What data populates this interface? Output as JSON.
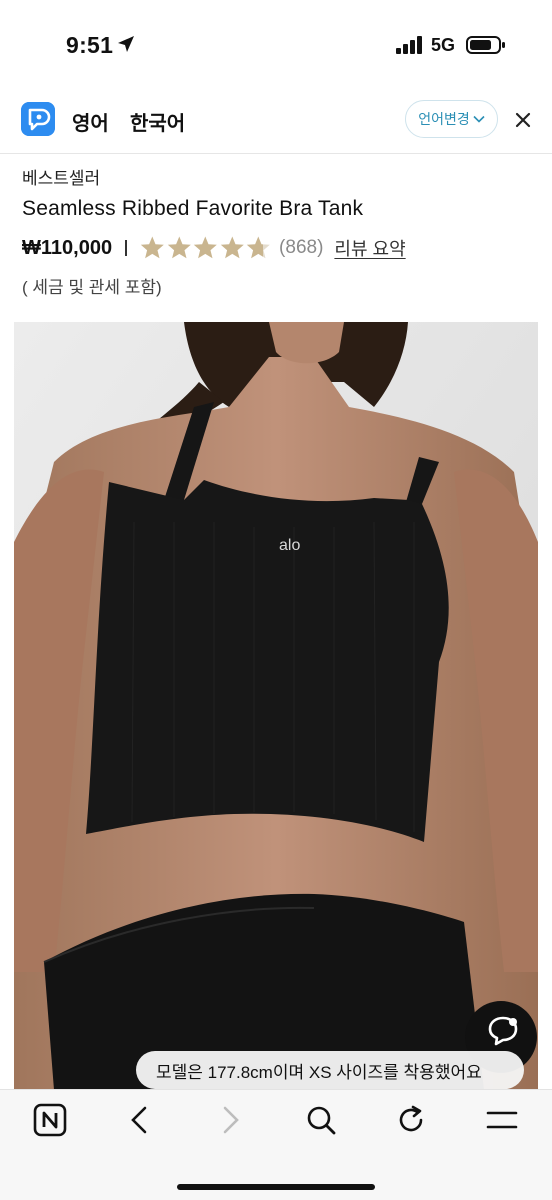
{
  "status_bar": {
    "time": "9:51",
    "network": "5G"
  },
  "translate_bar": {
    "language_active": "영어",
    "language_other": "한국어",
    "change_language_label": "언어변경"
  },
  "product": {
    "badge": "베스트셀러",
    "title": "Seamless Ribbed Favorite Bra Tank",
    "price": "₩110,000",
    "rating": 4.7,
    "rating_max": 5,
    "review_count": "(868)",
    "review_summary_link": "리뷰 요약",
    "tax_note": "( 세금 및 관세 포함)",
    "image_logo": "alo",
    "size_note": "모델은 177.8cm이며 XS 사이즈를 착용했어요"
  },
  "colors": {
    "star_fill": "#c9b58f",
    "star_empty": "#e4dccd",
    "accent_blue": "#2d8cf0",
    "link_teal": "#2b8fb5"
  },
  "browser_bar": {
    "icons": [
      "naver-home-icon",
      "back-icon",
      "forward-icon",
      "search-icon",
      "refresh-icon",
      "menu-icon"
    ]
  }
}
